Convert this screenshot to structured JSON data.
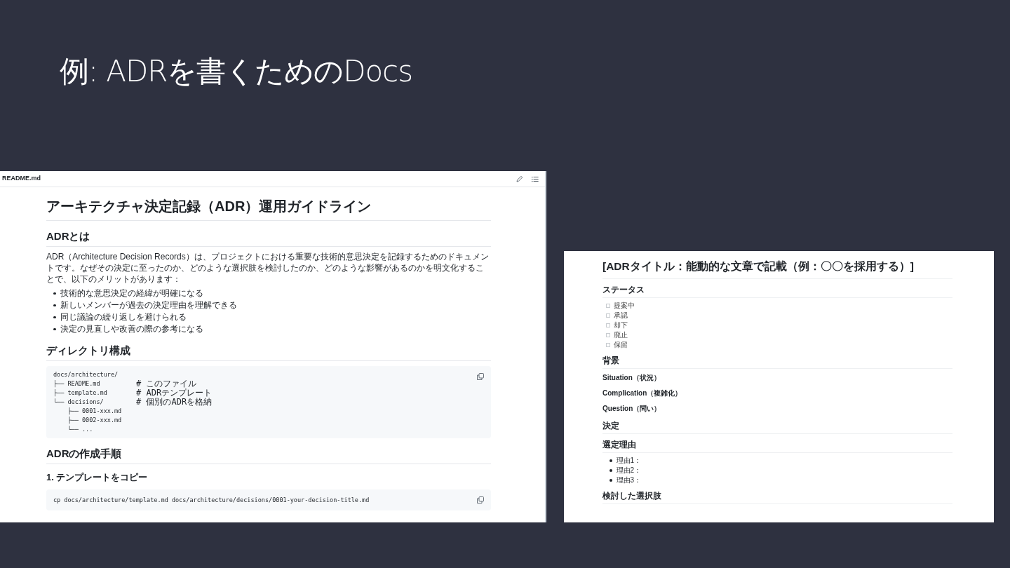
{
  "slide_title": "例: ADRを書くためのDocs",
  "readme": {
    "file_name": "README.md",
    "blocks": [
      {
        "kind": "h1",
        "text": "アーキテクチャ決定記録（ADR）運用ガイドライン"
      },
      {
        "kind": "h2",
        "text": "ADRとは"
      },
      {
        "kind": "paragraph",
        "text": "ADR（Architecture Decision Records）は、プロジェクトにおける重要な技術的意思決定を記録するためのドキュメントです。なぜその決定に至ったのか、どのような選択肢を検討したのか、どのような影響があるのかを明文化することで、以下のメリットがあります："
      },
      {
        "kind": "bullets",
        "items": [
          "技術的な意思決定の経緯が明確になる",
          "新しいメンバーが過去の決定理由を理解できる",
          "同じ議論の繰り返しを避けられる",
          "決定の見直しや改善の際の参考になる"
        ]
      },
      {
        "kind": "h2",
        "text": "ディレクトリ構成"
      },
      {
        "kind": "code_tree",
        "lines": [
          {
            "path": "docs/architecture/"
          },
          {
            "path": "├── README.md",
            "comment": "# このファイル"
          },
          {
            "path": "├── template.md",
            "comment": "# ADRテンプレート"
          },
          {
            "path": "└── decisions/",
            "comment": "# 個別のADRを格納"
          },
          {
            "path": "    ├── 0001-xxx.md"
          },
          {
            "path": "    ├── 0002-xxx.md"
          },
          {
            "path": "    └── ..."
          }
        ]
      },
      {
        "kind": "h2",
        "text": "ADRの作成手順"
      },
      {
        "kind": "h3",
        "text": "1. テンプレートをコピー"
      },
      {
        "kind": "code",
        "text": "cp docs/architecture/template.md docs/architecture/decisions/0001-your-decision-title.md"
      }
    ]
  },
  "template": {
    "blocks": [
      {
        "kind": "h1",
        "text": "[ADRタイトル：能動的な文章で記載（例：〇〇を採用する）]"
      },
      {
        "kind": "h2",
        "text": "ステータス"
      },
      {
        "kind": "checklist",
        "items": [
          {
            "label": "提案中",
            "checked": false
          },
          {
            "label": "承認",
            "checked": false
          },
          {
            "label": "却下",
            "checked": false
          },
          {
            "label": "廃止",
            "checked": false
          },
          {
            "label": "保留",
            "checked": false
          }
        ]
      },
      {
        "kind": "h2",
        "text": "背景"
      },
      {
        "kind": "h4",
        "text": "Situation（状況）"
      },
      {
        "kind": "h4",
        "text": "Complication（複雑化）"
      },
      {
        "kind": "h4",
        "text": "Question（問い）"
      },
      {
        "kind": "h2",
        "text": "決定"
      },
      {
        "kind": "h2",
        "text": "選定理由"
      },
      {
        "kind": "bullets",
        "items": [
          "理由1：",
          "理由2：",
          "理由3："
        ]
      },
      {
        "kind": "h2",
        "text": "検討した選択肢"
      }
    ]
  }
}
